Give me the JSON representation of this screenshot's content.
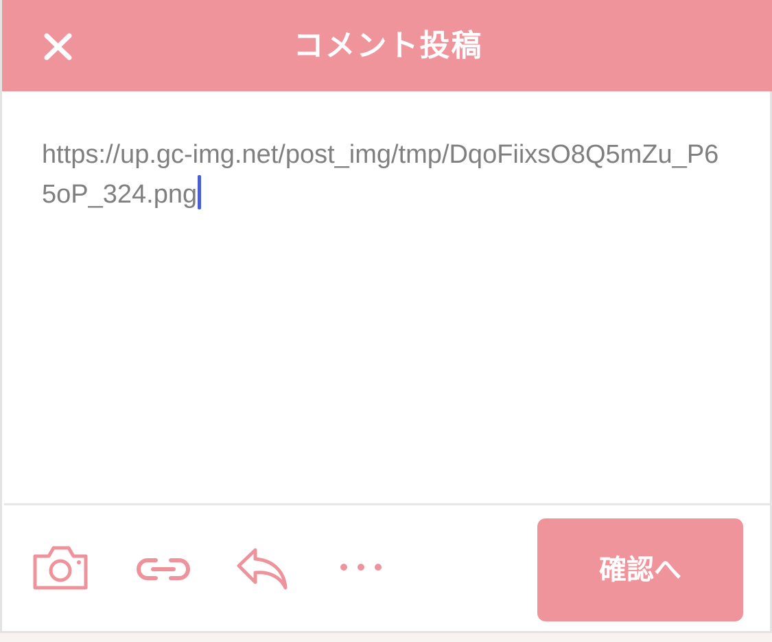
{
  "header": {
    "title": "コメント投稿",
    "close_icon": "close-icon",
    "background_color": "#f0949c"
  },
  "editor": {
    "value": "https://up.gc-img.net/post_img/tmp/DqoFiixsO8Q5mZu_P65oP_324.png",
    "text_color": "#7f7f7f",
    "caret_color": "#4a5fd4"
  },
  "toolbar": {
    "icons": [
      "camera-icon",
      "link-icon",
      "reply-icon",
      "more-icon"
    ],
    "confirm_label": "確認へ",
    "accent_color": "#f0949c"
  }
}
